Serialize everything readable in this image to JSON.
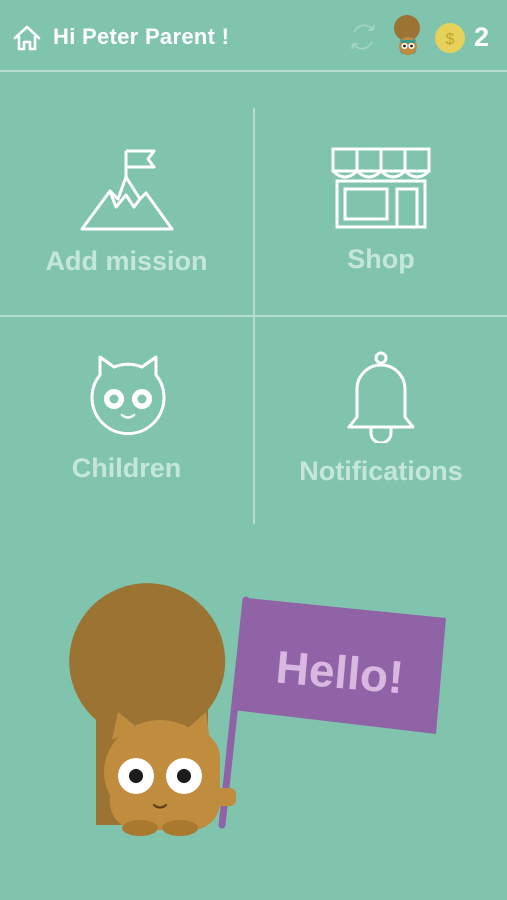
{
  "header": {
    "greeting": "Hi Peter Parent !",
    "coins": "2",
    "icons": [
      "home-icon",
      "sync-icon",
      "avatar",
      "coin-icon"
    ]
  },
  "menu": [
    {
      "label": "Add mission",
      "icon": "mountain-flag-icon"
    },
    {
      "label": "Shop",
      "icon": "storefront-icon"
    },
    {
      "label": "Children",
      "icon": "owl-face-icon"
    },
    {
      "label": "Notifications",
      "icon": "bell-icon"
    }
  ],
  "mascot": {
    "flag_text": "Hello!"
  },
  "colors": {
    "background": "#80c4ae",
    "divider": "#b6dccf",
    "label": "#c5e6dc",
    "squirrel_tail": "#9b7433",
    "squirrel_body": "#c08c3e",
    "flag": "#9063a6",
    "flag_text": "#d8b8e0",
    "coin": "#e6d25a"
  }
}
